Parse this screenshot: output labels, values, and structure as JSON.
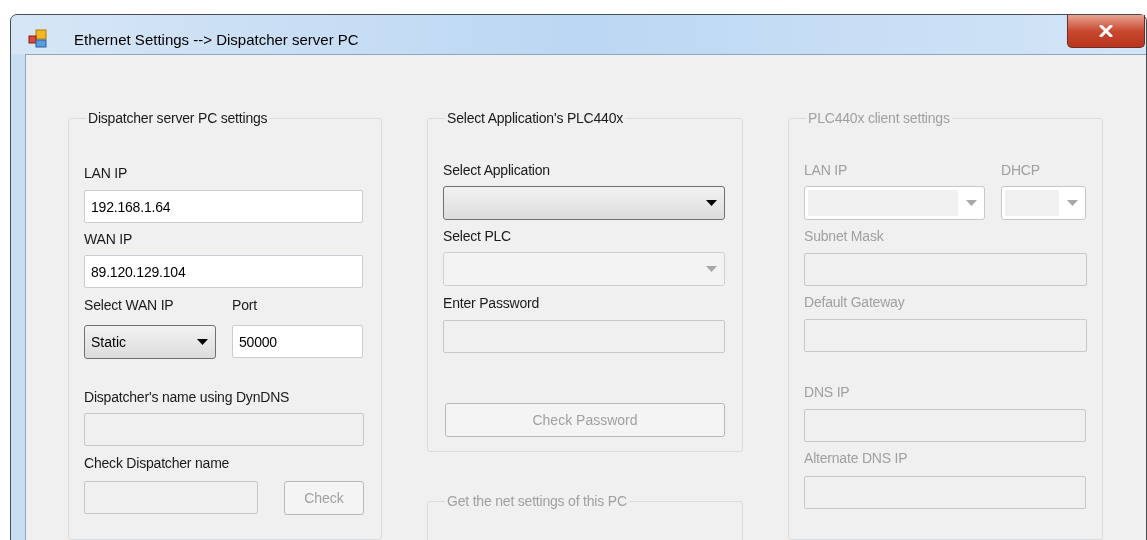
{
  "window": {
    "title": "Ethernet Settings --> Dispatcher server PC"
  },
  "server_settings": {
    "title": "Dispatcher server PC settings",
    "disabled": false,
    "lan_ip": {
      "label": "LAN IP",
      "value": "192.168.1.64",
      "disabled": false
    },
    "wan_ip": {
      "label": "WAN IP",
      "value": "89.120.129.104",
      "disabled": false
    },
    "wan_ip_mode": {
      "label": "Select WAN IP",
      "value": "Static",
      "disabled": false
    },
    "port": {
      "label": "Port",
      "value": "50000",
      "disabled": false
    },
    "dyndns_name": {
      "label": "Dispatcher's name using DynDNS",
      "disabled": true
    },
    "check_name": {
      "label": "Check Dispatcher name",
      "disabled": true
    },
    "check_button": {
      "label": "Check",
      "disabled": true
    }
  },
  "application": {
    "title": "Select Application's  PLC440x",
    "disabled": false,
    "select_application": {
      "label": "Select Application",
      "disabled": false
    },
    "select_plc": {
      "label": "Select PLC",
      "disabled": true
    },
    "password": {
      "label": "Enter Password",
      "disabled": true
    },
    "check_button": {
      "label": "Check Password",
      "disabled": true
    }
  },
  "net_settings": {
    "title": "Get the net settings of this PC",
    "disabled": true
  },
  "client_settings": {
    "title": "PLC440x  client settings",
    "disabled": true,
    "lan_ip": {
      "label": "LAN IP",
      "disabled": true
    },
    "dhcp": {
      "label": "DHCP",
      "disabled": true
    },
    "subnet_mask": {
      "label": "Subnet Mask",
      "disabled": true
    },
    "gateway": {
      "label": "Default Gateway",
      "disabled": true
    },
    "dns_ip": {
      "label": "DNS IP",
      "disabled": true
    },
    "alt_dns_ip": {
      "label": "Alternate DNS IP",
      "disabled": true
    }
  }
}
